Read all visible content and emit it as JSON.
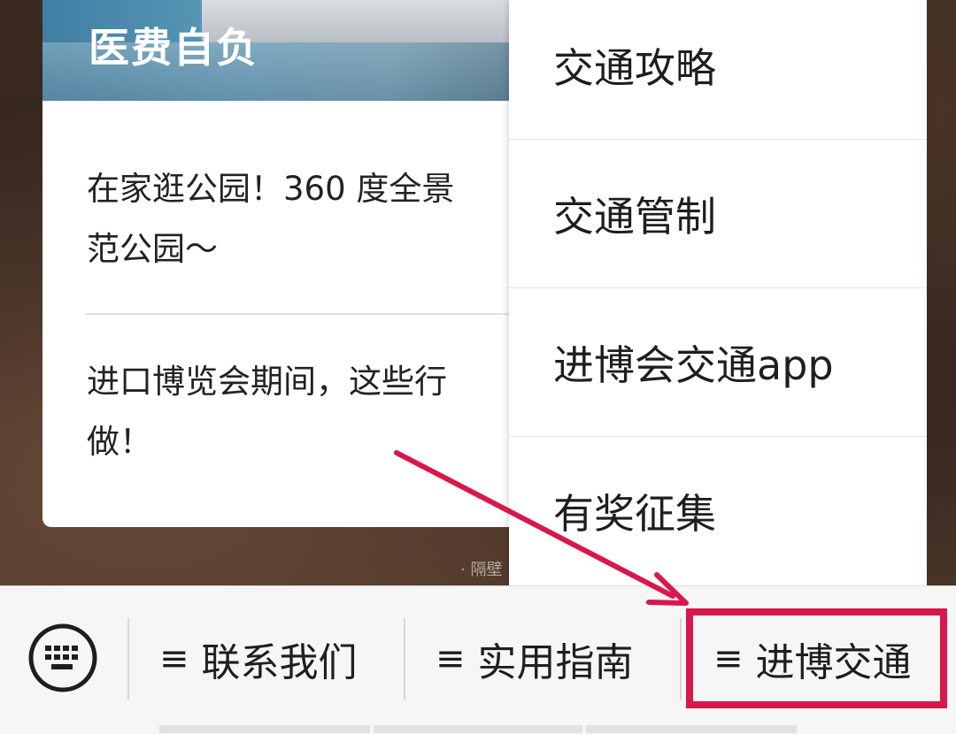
{
  "background": {
    "caption_fragment": "· 隔壁"
  },
  "article_card": {
    "banner_title": "医费自负",
    "items": [
      {
        "text_line1": "在家逛公园！360 度全景",
        "text_line2": "范公园～"
      },
      {
        "text_line1": "进口博览会期间，这些行",
        "text_line2": "做！"
      }
    ]
  },
  "popup_menu": {
    "items": [
      {
        "label": "交通攻略"
      },
      {
        "label": "交通管制"
      },
      {
        "label": "进博会交通app"
      },
      {
        "label": "有奖征集"
      }
    ]
  },
  "bottom_bar": {
    "keyboard_icon": "keyboard-icon",
    "tabs": [
      {
        "menu_icon": "≡",
        "label": "联系我们"
      },
      {
        "menu_icon": "≡",
        "label": "实用指南"
      },
      {
        "menu_icon": "≡",
        "label": "进博交通"
      }
    ]
  },
  "annotations": {
    "highlight_color": "#d8184a",
    "arrow_color": "#d8184a"
  }
}
